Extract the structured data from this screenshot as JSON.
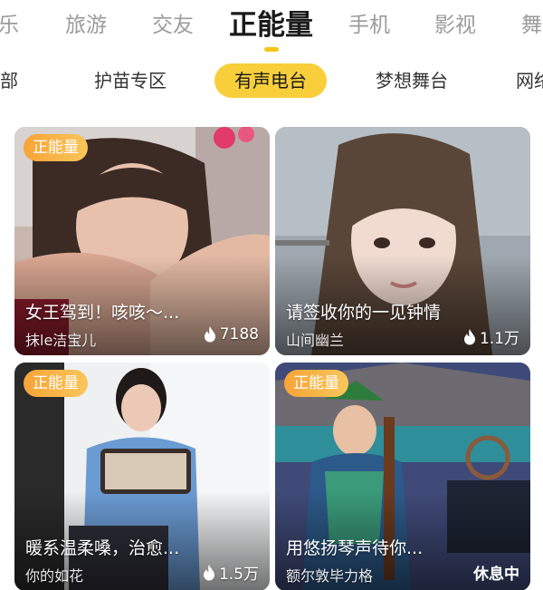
{
  "top_tabs": [
    {
      "label": "乐"
    },
    {
      "label": "旅游"
    },
    {
      "label": "交友"
    },
    {
      "label": "正能量"
    },
    {
      "label": "手机"
    },
    {
      "label": "影视"
    },
    {
      "label": "舞"
    }
  ],
  "active_top_tab": "正能量",
  "sub_tabs": [
    {
      "label": "全部"
    },
    {
      "label": "护苗专区"
    },
    {
      "label": "有声电台"
    },
    {
      "label": "梦想舞台"
    },
    {
      "label": "网络"
    }
  ],
  "active_sub_tab": "有声电台",
  "cards": [
    {
      "badge": "正能量",
      "title": "女王驾到！咳咳～...",
      "author": "抹le洁宝儿",
      "stat": "7188",
      "stat_icon": "fire-icon",
      "status": ""
    },
    {
      "badge": "",
      "title": "请签收你的一见钟情",
      "author": "山间幽兰",
      "stat": "1.1万",
      "stat_icon": "fire-icon",
      "status": ""
    },
    {
      "badge": "正能量",
      "title": "暖系温柔嗓，治愈...",
      "author": "你的如花",
      "stat": "1.5万",
      "stat_icon": "fire-icon",
      "status": ""
    },
    {
      "badge": "正能量",
      "title": "用悠扬琴声待你...",
      "author": "额尔敦毕力格",
      "stat": "",
      "stat_icon": "",
      "status": "休息中"
    }
  ],
  "colors": {
    "accent": "#f8cf3b",
    "badge_start": "#f8a338",
    "badge_end": "#f9c65a",
    "active_text": "#1a1a1a",
    "inactive_text": "#9b9b9b"
  }
}
